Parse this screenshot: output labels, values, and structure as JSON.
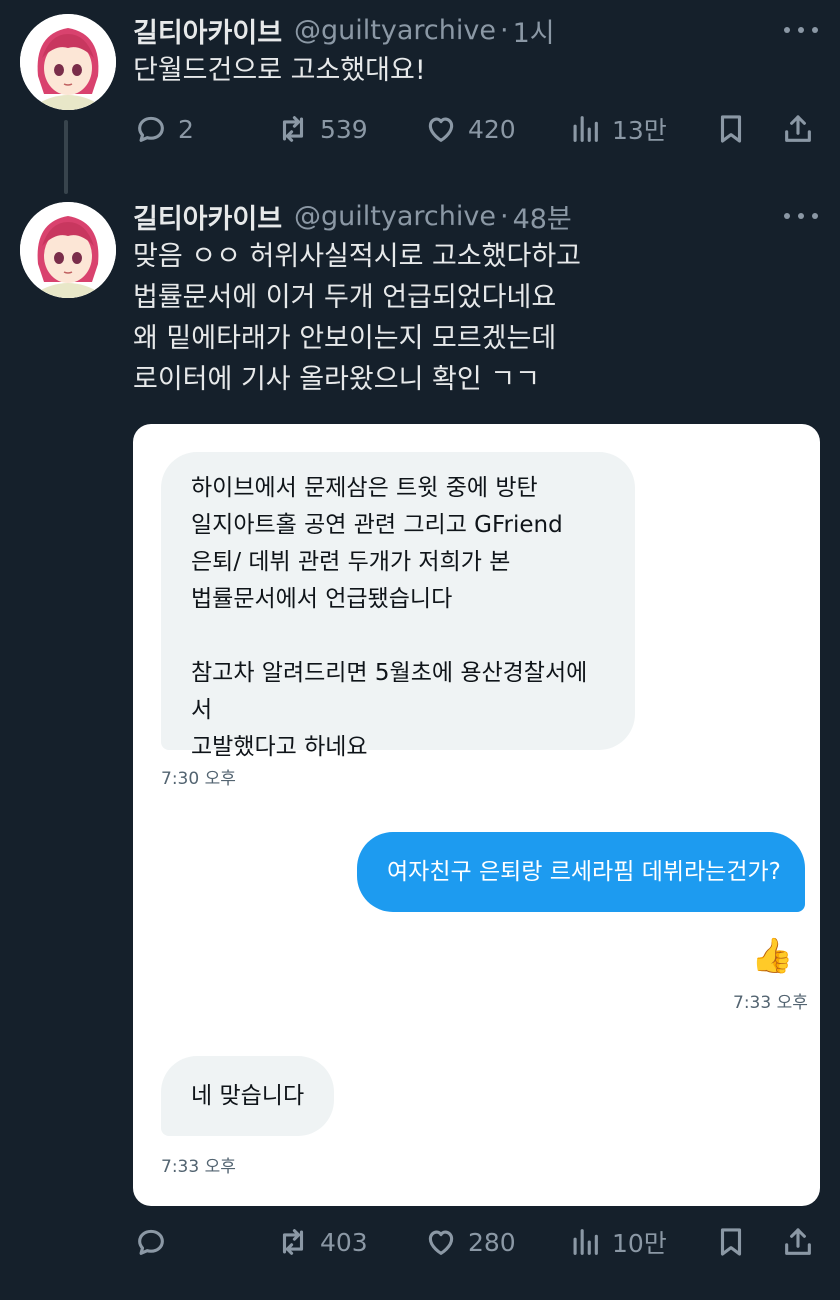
{
  "tweets": [
    {
      "name": "길티아카이브",
      "handle": "@guiltyarchive",
      "separator": "·",
      "time": "1시",
      "text": "단월드건으로 고소했대요!",
      "stats": {
        "replies": "2",
        "retweets": "539",
        "likes": "420",
        "views": "13만"
      }
    },
    {
      "name": "길티아카이브",
      "handle": "@guiltyarchive",
      "separator": "·",
      "time": "48분",
      "text": "맞음 ㅇㅇ 허위사실적시로 고소했다하고\n법률문서에 이거 두개 언급되었다네요\n왜 밑에타래가 안보이는지 모르겠는데\n로이터에 기사 올라왔으니 확인 ㄱㄱ",
      "stats": {
        "replies": "",
        "retweets": "403",
        "likes": "280",
        "views": "10만"
      }
    }
  ],
  "dm": {
    "msg1": "하이브에서 문제삼은 트윗 중에 방탄\n일지아트홀 공연 관련 그리고 GFriend\n은퇴/ 데뷔 관련 두개가 저희가 본\n법률문서에서 언급됐습니다\n\n참고차 알려드리면 5월초에 용산경찰서에서\n고발했다고 하네요",
    "msg1_time": "7:30 오후",
    "msg2": "여자친구 은퇴랑 르세라핌 데뷔라는건가?",
    "reaction": "👍",
    "msg2_time": "7:33 오후",
    "msg3": "네 맞습니다",
    "msg3_time": "7:33 오후"
  },
  "colors": {
    "background": "#15202b",
    "text_primary": "#e7e9ea",
    "text_secondary": "#8b98a5",
    "accent": "#1d9bf0",
    "bubble_gray": "#eff3f4"
  },
  "icons": [
    "reply-icon",
    "retweet-icon",
    "like-icon",
    "views-icon",
    "bookmark-icon",
    "share-icon",
    "more-icon",
    "thumbs-up-icon"
  ]
}
